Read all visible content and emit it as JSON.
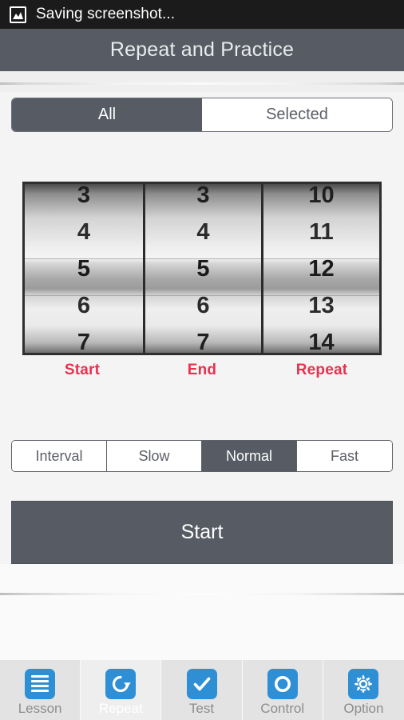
{
  "statusbar": {
    "icon": "screenshot-image-icon",
    "text": "Saving screenshot..."
  },
  "titlebar": {
    "title": "Repeat and Practice"
  },
  "scope_tabs": {
    "items": [
      {
        "label": "All",
        "active": true
      },
      {
        "label": "Selected",
        "active": false
      }
    ]
  },
  "picker": {
    "wheels": [
      {
        "label": "Start",
        "items": [
          "3",
          "4",
          "5",
          "6",
          "7"
        ],
        "selected": "5",
        "selected_index": 2
      },
      {
        "label": "End",
        "items": [
          "3",
          "4",
          "5",
          "6",
          "7"
        ],
        "selected": "5",
        "selected_index": 2
      },
      {
        "label": "Repeat",
        "items": [
          "10",
          "11",
          "12",
          "13",
          "14"
        ],
        "selected": "12",
        "selected_index": 2
      }
    ],
    "label_color": "#e8314f"
  },
  "speed": {
    "segments": [
      {
        "label": "Interval",
        "active": false
      },
      {
        "label": "Slow",
        "active": false
      },
      {
        "label": "Normal",
        "active": true
      },
      {
        "label": "Fast",
        "active": false
      }
    ]
  },
  "action": {
    "start_label": "Start"
  },
  "navbar": {
    "items": [
      {
        "label": "Lesson",
        "icon": "list-icon",
        "active": false
      },
      {
        "label": "Repeat",
        "icon": "repeat-icon",
        "active": true
      },
      {
        "label": "Test",
        "icon": "check-icon",
        "active": false
      },
      {
        "label": "Control",
        "icon": "circle-icon",
        "active": false
      },
      {
        "label": "Option",
        "icon": "gear-icon",
        "active": false
      }
    ]
  },
  "colors": {
    "accent_blue": "#2f8fd4",
    "header_gray": "#575b63",
    "label_red": "#e8314f"
  }
}
